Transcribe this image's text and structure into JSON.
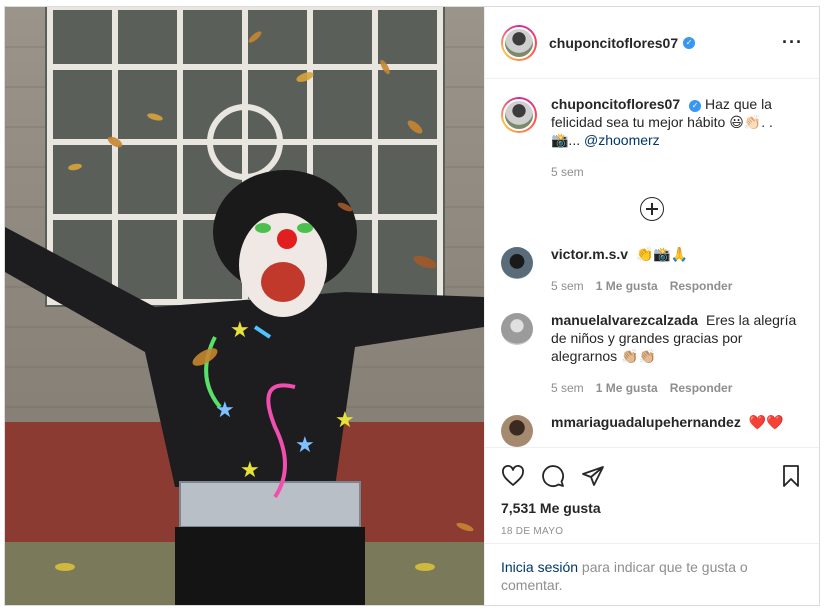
{
  "post": {
    "username": "chuponcitoflores07",
    "menu_icon": "more-horizontal-icon"
  },
  "caption": {
    "username": "chuponcitoflores07",
    "text": "Haz que la felicidad sea tu mejor hábito 😃👏🏻. . 📸... ",
    "mention": "@zhoomerz",
    "time": "5 sem"
  },
  "comments": [
    {
      "username": "victor.m.s.v",
      "text": "👏📸🙏",
      "time": "5 sem",
      "likes": "1 Me gusta",
      "reply": "Responder"
    },
    {
      "username": "manuelalvarezcalzada",
      "text": "Eres la alegría de niños y grandes gracias por alegrarnos 👏🏼👏🏼",
      "time": "5 sem",
      "likes": "1 Me gusta",
      "reply": "Responder"
    },
    {
      "username": "mmariaguadalupehernandez",
      "text": "❤️❤️",
      "time": "",
      "likes": "",
      "reply": ""
    }
  ],
  "stats": {
    "likes": "7,531 Me gusta",
    "date": "18 DE MAYO"
  },
  "login": {
    "link": "Inicia sesión",
    "text": " para indicar que te gusta o comentar."
  },
  "colors": {
    "accent_link": "#00376b",
    "verified": "#3897f0",
    "muted": "#8e8e8e"
  }
}
